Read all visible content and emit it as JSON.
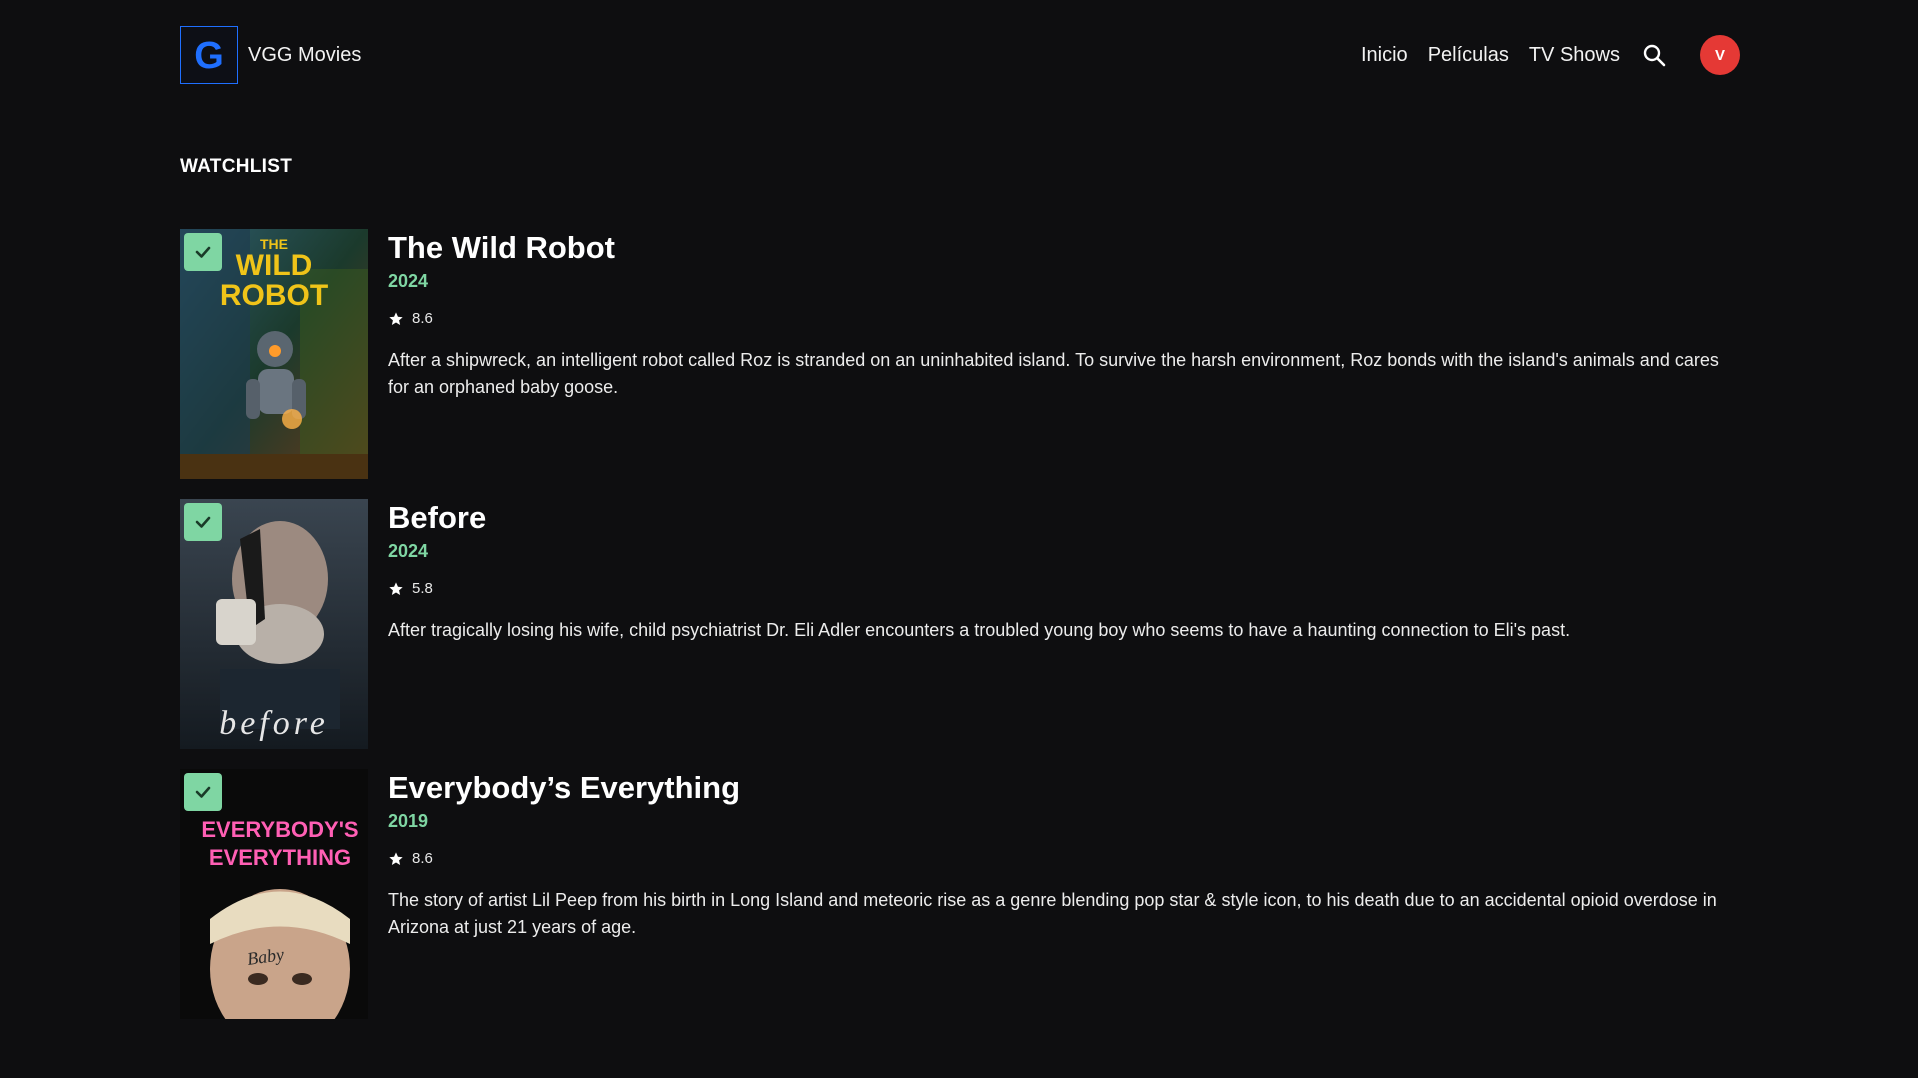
{
  "header": {
    "brand_name": "VGG Movies",
    "logo_letter": "G",
    "nav": [
      "Inicio",
      "Películas",
      "TV Shows"
    ],
    "avatar_initial": "V"
  },
  "section": {
    "title": "WATCHLIST"
  },
  "colors": {
    "accent_green": "#7fd6a3",
    "avatar_red": "#e53935",
    "brand_blue": "#1f6fff",
    "background": "#0e0e10"
  },
  "movies": [
    {
      "title": "The Wild Robot",
      "year": "2024",
      "rating": "8.6",
      "description": "After a shipwreck, an intelligent robot called Roz is stranded on an uninhabited island. To survive the harsh environment, Roz bonds with the island's animals and cares for an orphaned baby goose.",
      "poster_text": [
        "THE",
        "WILD",
        "ROBOT"
      ]
    },
    {
      "title": "Before",
      "year": "2024",
      "rating": "5.8",
      "description": "After tragically losing his wife, child psychiatrist Dr. Eli Adler encounters a troubled young boy who seems to have a haunting connection to Eli's past.",
      "poster_text": [
        "before"
      ]
    },
    {
      "title": "Everybody’s Everything",
      "year": "2019",
      "rating": "8.6",
      "description": "The story of artist Lil Peep from his birth in Long Island and meteoric rise as a genre blending pop star & style icon, to his death due to an accidental opioid overdose in Arizona at just 21 years of age.",
      "poster_text": [
        "EVERYBODY'S",
        "EVERYTHING"
      ]
    }
  ]
}
